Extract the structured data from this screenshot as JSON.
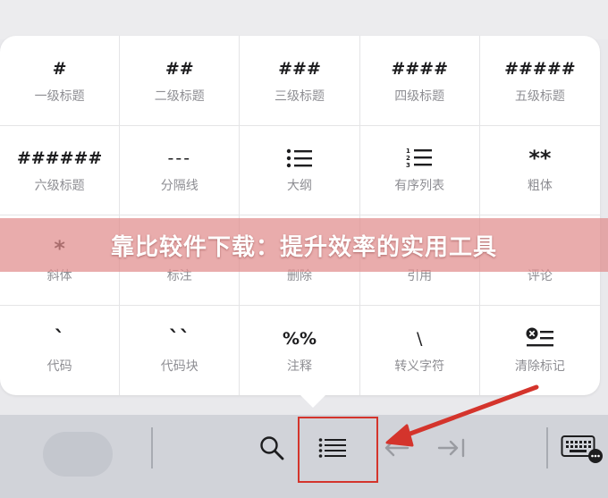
{
  "banner": {
    "title": "靠比较件下载：提升效率的实用工具"
  },
  "grid": {
    "items": [
      {
        "symbol": "#",
        "label": "一级标题",
        "icon": ""
      },
      {
        "symbol": "##",
        "label": "二级标题",
        "icon": ""
      },
      {
        "symbol": "###",
        "label": "三级标题",
        "icon": ""
      },
      {
        "symbol": "####",
        "label": "四级标题",
        "icon": ""
      },
      {
        "symbol": "#####",
        "label": "五级标题",
        "icon": ""
      },
      {
        "symbol": "######",
        "label": "六级标题",
        "icon": ""
      },
      {
        "symbol": "---",
        "label": "分隔线",
        "icon": ""
      },
      {
        "symbol": "",
        "label": "大纲",
        "icon": "bullet-list-icon"
      },
      {
        "symbol": "",
        "label": "有序列表",
        "icon": "numbered-list-icon"
      },
      {
        "symbol": "**",
        "label": "粗体",
        "icon": ""
      },
      {
        "symbol": "*",
        "label": "斜体",
        "icon": ""
      },
      {
        "symbol": "",
        "label": "标注",
        "icon": ""
      },
      {
        "symbol": "",
        "label": "删除",
        "icon": ""
      },
      {
        "symbol": "",
        "label": "引用",
        "icon": ""
      },
      {
        "symbol": "",
        "label": "评论",
        "icon": ""
      },
      {
        "symbol": "`",
        "label": "代码",
        "icon": ""
      },
      {
        "symbol": "``",
        "label": "代码块",
        "icon": ""
      },
      {
        "symbol": "%%",
        "label": "注释",
        "icon": ""
      },
      {
        "symbol": "\\",
        "label": "转义字符",
        "icon": ""
      },
      {
        "symbol": "",
        "label": "清除标记",
        "icon": "clear-format-icon"
      }
    ]
  },
  "toolbar": {
    "icons": [
      "search-icon",
      "list-format-icon",
      "undo-arrow-icon",
      "tab-forward-icon",
      "keyboard-icon"
    ]
  },
  "colors": {
    "highlight": "#d4342c",
    "arrow": "#d4342c",
    "banner": "#e08c8c"
  }
}
